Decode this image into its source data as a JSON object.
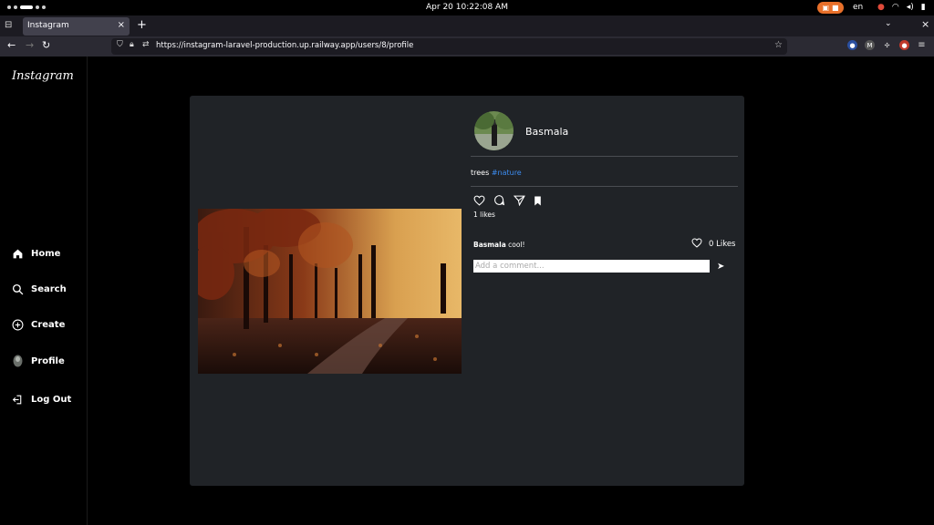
{
  "system": {
    "clock": "Apr 20  10:22:08 AM",
    "lang": "en"
  },
  "browser": {
    "tab_title": "Instagram",
    "url": "https://instagram-laravel-production.up.railway.app/users/8/profile"
  },
  "sidebar": {
    "logo": "Instagram",
    "items": [
      {
        "label": "Home",
        "icon": "home-icon"
      },
      {
        "label": "Search",
        "icon": "search-icon"
      },
      {
        "label": "Create",
        "icon": "plus-circle-icon"
      },
      {
        "label": "Profile",
        "icon": "avatar"
      },
      {
        "label": "Log Out",
        "icon": "logout-icon"
      }
    ]
  },
  "post": {
    "username": "Basmala",
    "caption_text": "trees ",
    "hashtag": "#nature",
    "likes_text": "1 likes",
    "comment": {
      "author": "Basmala",
      "text": " cool!",
      "likes_text": "0 Likes"
    },
    "comment_placeholder": "Add a comment..."
  },
  "colors": {
    "card_bg": "#202327",
    "hashtag": "#3c8cf0",
    "indicator": "#e8702a"
  }
}
